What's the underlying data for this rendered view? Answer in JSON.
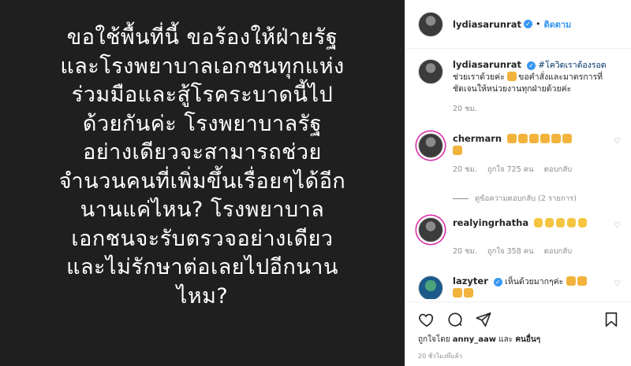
{
  "post_image": {
    "lines": [
      "ขอใช้พื้นที่นี้ ขอร้องให้ฝ่ายรัฐ",
      "และโรงพยาบาลเอกชนทุกแห่ง",
      "ร่วมมือและสู้โรคระบาดนี้ไป",
      "ด้วยกันค่ะ โรงพยาบาลรัฐ",
      "อย่างเดียวจะสามารถช่วย",
      "จำนวนคนที่เพิ่มขึ้นเรื่อยๆได้อีก",
      "นานแค่ไหน? โรงพยาบาล",
      "เอกชนจะรับตรวจอย่างเดียว",
      "และไม่รักษาต่อเลยไปอีกนาน",
      "ไหม?"
    ]
  },
  "header": {
    "username": "lydiasarunrat",
    "separator": "•",
    "follow_label": "ติดตาม"
  },
  "caption": {
    "username": "lydiasarunrat",
    "hashtag": "#โควิดเราต้องรอด",
    "text_1": " ช่วยเราด้วยค่ะ ",
    "text_2": "ขอคำสั่งและมาตรการที่ชัดเจนให้หน่วยงานทุกฝ่ายด้วยค่ะ",
    "time": "20 ชม."
  },
  "comments": [
    {
      "username": "chermarn",
      "time": "20 ชม.",
      "likes": "ถูกใจ 725 คน",
      "reply": "ตอบกลับ",
      "view_replies": "ดูข้อความตอบกลับ (2 รายการ)",
      "emoji": "pray",
      "emoji_count": 7
    },
    {
      "username": "realyingrhatha",
      "time": "20 ชม.",
      "likes": "ถูกใจ 358 คน",
      "reply": "ตอบกลับ",
      "emoji": "ok_hand",
      "emoji_count": 5
    },
    {
      "username": "lazyter",
      "text": "เห็นด้วยมากๆค่ะ",
      "emoji": "pray",
      "emoji_count": 4
    }
  ],
  "footer": {
    "liked_by_prefix": "ถูกใจโดย ",
    "liked_by_user": "anny_aaw",
    "liked_by_mid": " และ ",
    "liked_by_others": "คนอื่นๆ",
    "time": "20 ชั่วโมงที่แล้ว"
  },
  "icons": {
    "like": "heart-icon",
    "comment": "comment-icon",
    "share": "share-icon",
    "save": "bookmark-icon",
    "verified": "verified-badge-icon",
    "comment_like": "heart-icon"
  },
  "colors": {
    "image_bg": "#1f1f1f",
    "link": "#3897f0",
    "hashtag": "#003569",
    "muted": "#8e8e8e"
  }
}
